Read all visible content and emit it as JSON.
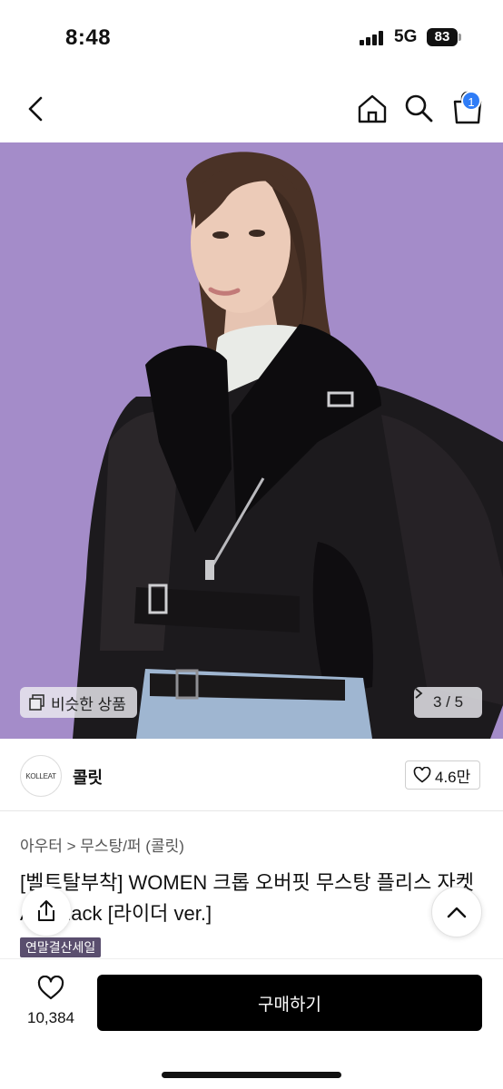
{
  "status": {
    "time": "8:48",
    "network": "5G",
    "battery": "83"
  },
  "header": {
    "cart_count": "1"
  },
  "hero": {
    "similar_label": "비슷한 상품",
    "pager": "3 / 5"
  },
  "brand": {
    "logo_text": "KOLLEAT",
    "name": "콜릿",
    "likes": "4.6만"
  },
  "product": {
    "breadcrumb": "아우터 > 무스탕/퍼 (콜릿)",
    "title": "[벨트탈부착] WOMEN 크롭 오버핏 무스탕 플리스 자켓 All_Black [라이더 ver.]",
    "sale_tag": "연말결산세일"
  },
  "footer": {
    "wish_count": "10,384",
    "buy_label": "구매하기"
  },
  "colors": {
    "hero_bg": "#a48cc9",
    "sale_tag": "#5a4e6e",
    "buy_button": "#000000",
    "badge": "#2f7cf6"
  }
}
